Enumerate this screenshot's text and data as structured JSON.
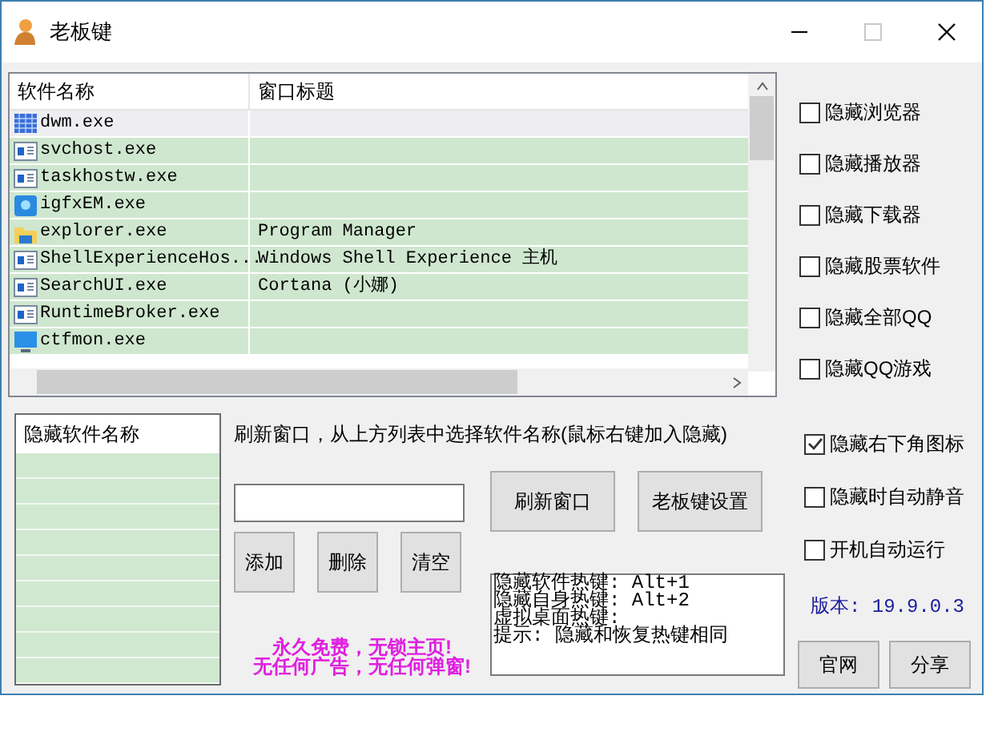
{
  "window": {
    "title": "老板键"
  },
  "process_list": {
    "columns": [
      "软件名称",
      "窗口标题"
    ],
    "rows": [
      {
        "kind": "grid",
        "name": "dwm.exe",
        "selected": true
      },
      {
        "kind": "app",
        "name": "svchost.exe",
        "selected": false
      },
      {
        "kind": "app",
        "name": "taskhostw.exe",
        "selected": false
      },
      {
        "kind": "badge",
        "name": "igfxEM.exe",
        "selected": false
      },
      {
        "kind": "folder",
        "name": "explorer.exe",
        "title": "Program Manager",
        "selected": false
      },
      {
        "kind": "app",
        "name": "ShellExperienceHos...",
        "title": "Windows Shell Experience 主机",
        "selected": false
      },
      {
        "kind": "app",
        "name": "SearchUI.exe",
        "title": "Cortana (小娜)",
        "selected": false
      },
      {
        "kind": "app",
        "name": "RuntimeBroker.exe",
        "selected": false
      },
      {
        "kind": "screen",
        "name": "ctfmon.exe",
        "selected": false
      }
    ]
  },
  "options_top": [
    {
      "label": "隐藏浏览器",
      "checked": false
    },
    {
      "label": "隐藏播放器",
      "checked": false
    },
    {
      "label": "隐藏下载器",
      "checked": false
    },
    {
      "label": "隐藏股票软件",
      "checked": false
    },
    {
      "label": "隐藏全部QQ",
      "checked": false
    },
    {
      "label": "隐藏QQ游戏",
      "checked": false
    }
  ],
  "hidden_list": {
    "header": "隐藏软件名称"
  },
  "hint": "刷新窗口，从上方列表中选择软件名称(鼠标右键加入隐藏)",
  "edit_buttons": [
    "添加",
    "删除",
    "清空"
  ],
  "action_buttons": [
    "刷新窗口",
    "老板键设置"
  ],
  "hotkeys": [
    "隐藏软件热键: Alt+1",
    "隐藏自身热键: Alt+2",
    "虚拟桌面热键:",
    "提示: 隐藏和恢复热键相同"
  ],
  "promo": [
    "永久免费，无锁主页!",
    "无任何广告，无任何弹窗!"
  ],
  "options_bottom": [
    {
      "label": "隐藏右下角图标",
      "checked": true
    },
    {
      "label": "隐藏时自动静音",
      "checked": false
    },
    {
      "label": "开机自动运行",
      "checked": false
    }
  ],
  "version": "版本: 19.9.0.3",
  "link_buttons": [
    "官网",
    "分享"
  ]
}
